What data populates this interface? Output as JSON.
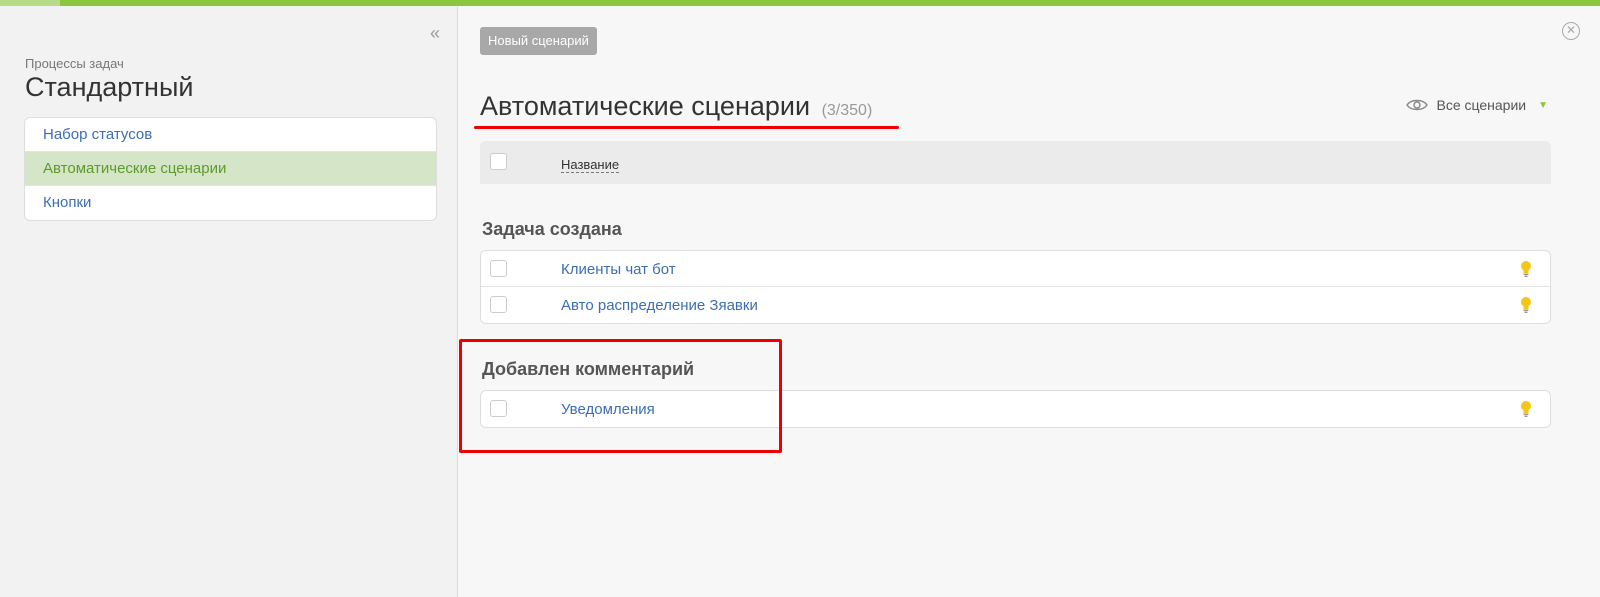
{
  "sidebar": {
    "crumb": "Процессы задач",
    "title": "Стандартный",
    "items": [
      {
        "label": "Набор статусов",
        "active": false
      },
      {
        "label": "Автоматические сценарии",
        "active": true
      },
      {
        "label": "Кнопки",
        "active": false
      }
    ]
  },
  "main": {
    "new_button": "Новый сценарий",
    "title": "Автоматические сценарии",
    "count": "(3/350)",
    "filter_label": "Все сценарии",
    "table_header": "Название",
    "groups": [
      {
        "title": "Задача создана",
        "rows": [
          "Клиенты чат бот",
          "Авто распределение Зяавки"
        ]
      },
      {
        "title": "Добавлен комментарий",
        "rows": [
          "Уведомления"
        ]
      }
    ]
  },
  "colors": {
    "accent_green": "#8cc63f",
    "link_blue": "#3c6eb4",
    "highlight_red": "#ee0000",
    "bulb_yellow": "#f5c518"
  },
  "icons": [
    "collapse-icon",
    "close-icon",
    "eye-icon",
    "chevron-down-icon",
    "bulb-icon"
  ]
}
